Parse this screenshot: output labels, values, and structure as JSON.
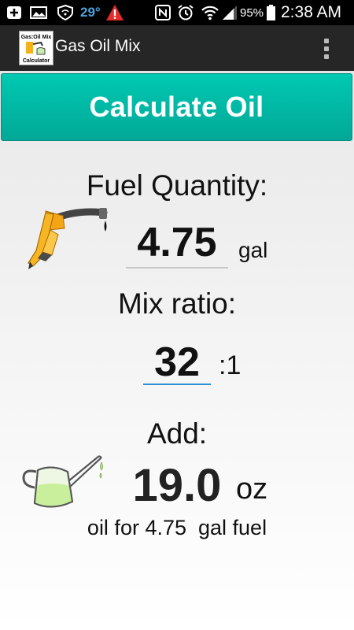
{
  "status_bar": {
    "temperature": "29°",
    "battery": "95%",
    "time": "2:38 AM"
  },
  "action_bar": {
    "title": "Gas Oil Mix",
    "app_icon_text": [
      "Gas:Oil Mix",
      "Calculator"
    ]
  },
  "calculate_button": {
    "label": "Calculate Oil"
  },
  "fuel": {
    "label": "Fuel Quantity:",
    "value": "4.75",
    "unit": "gal"
  },
  "ratio": {
    "label": "Mix ratio:",
    "value": "32",
    "suffix": ":1"
  },
  "result": {
    "label": "Add:",
    "value": "19.0",
    "unit": "oz",
    "summary": "oil for 4.75  gal fuel"
  }
}
